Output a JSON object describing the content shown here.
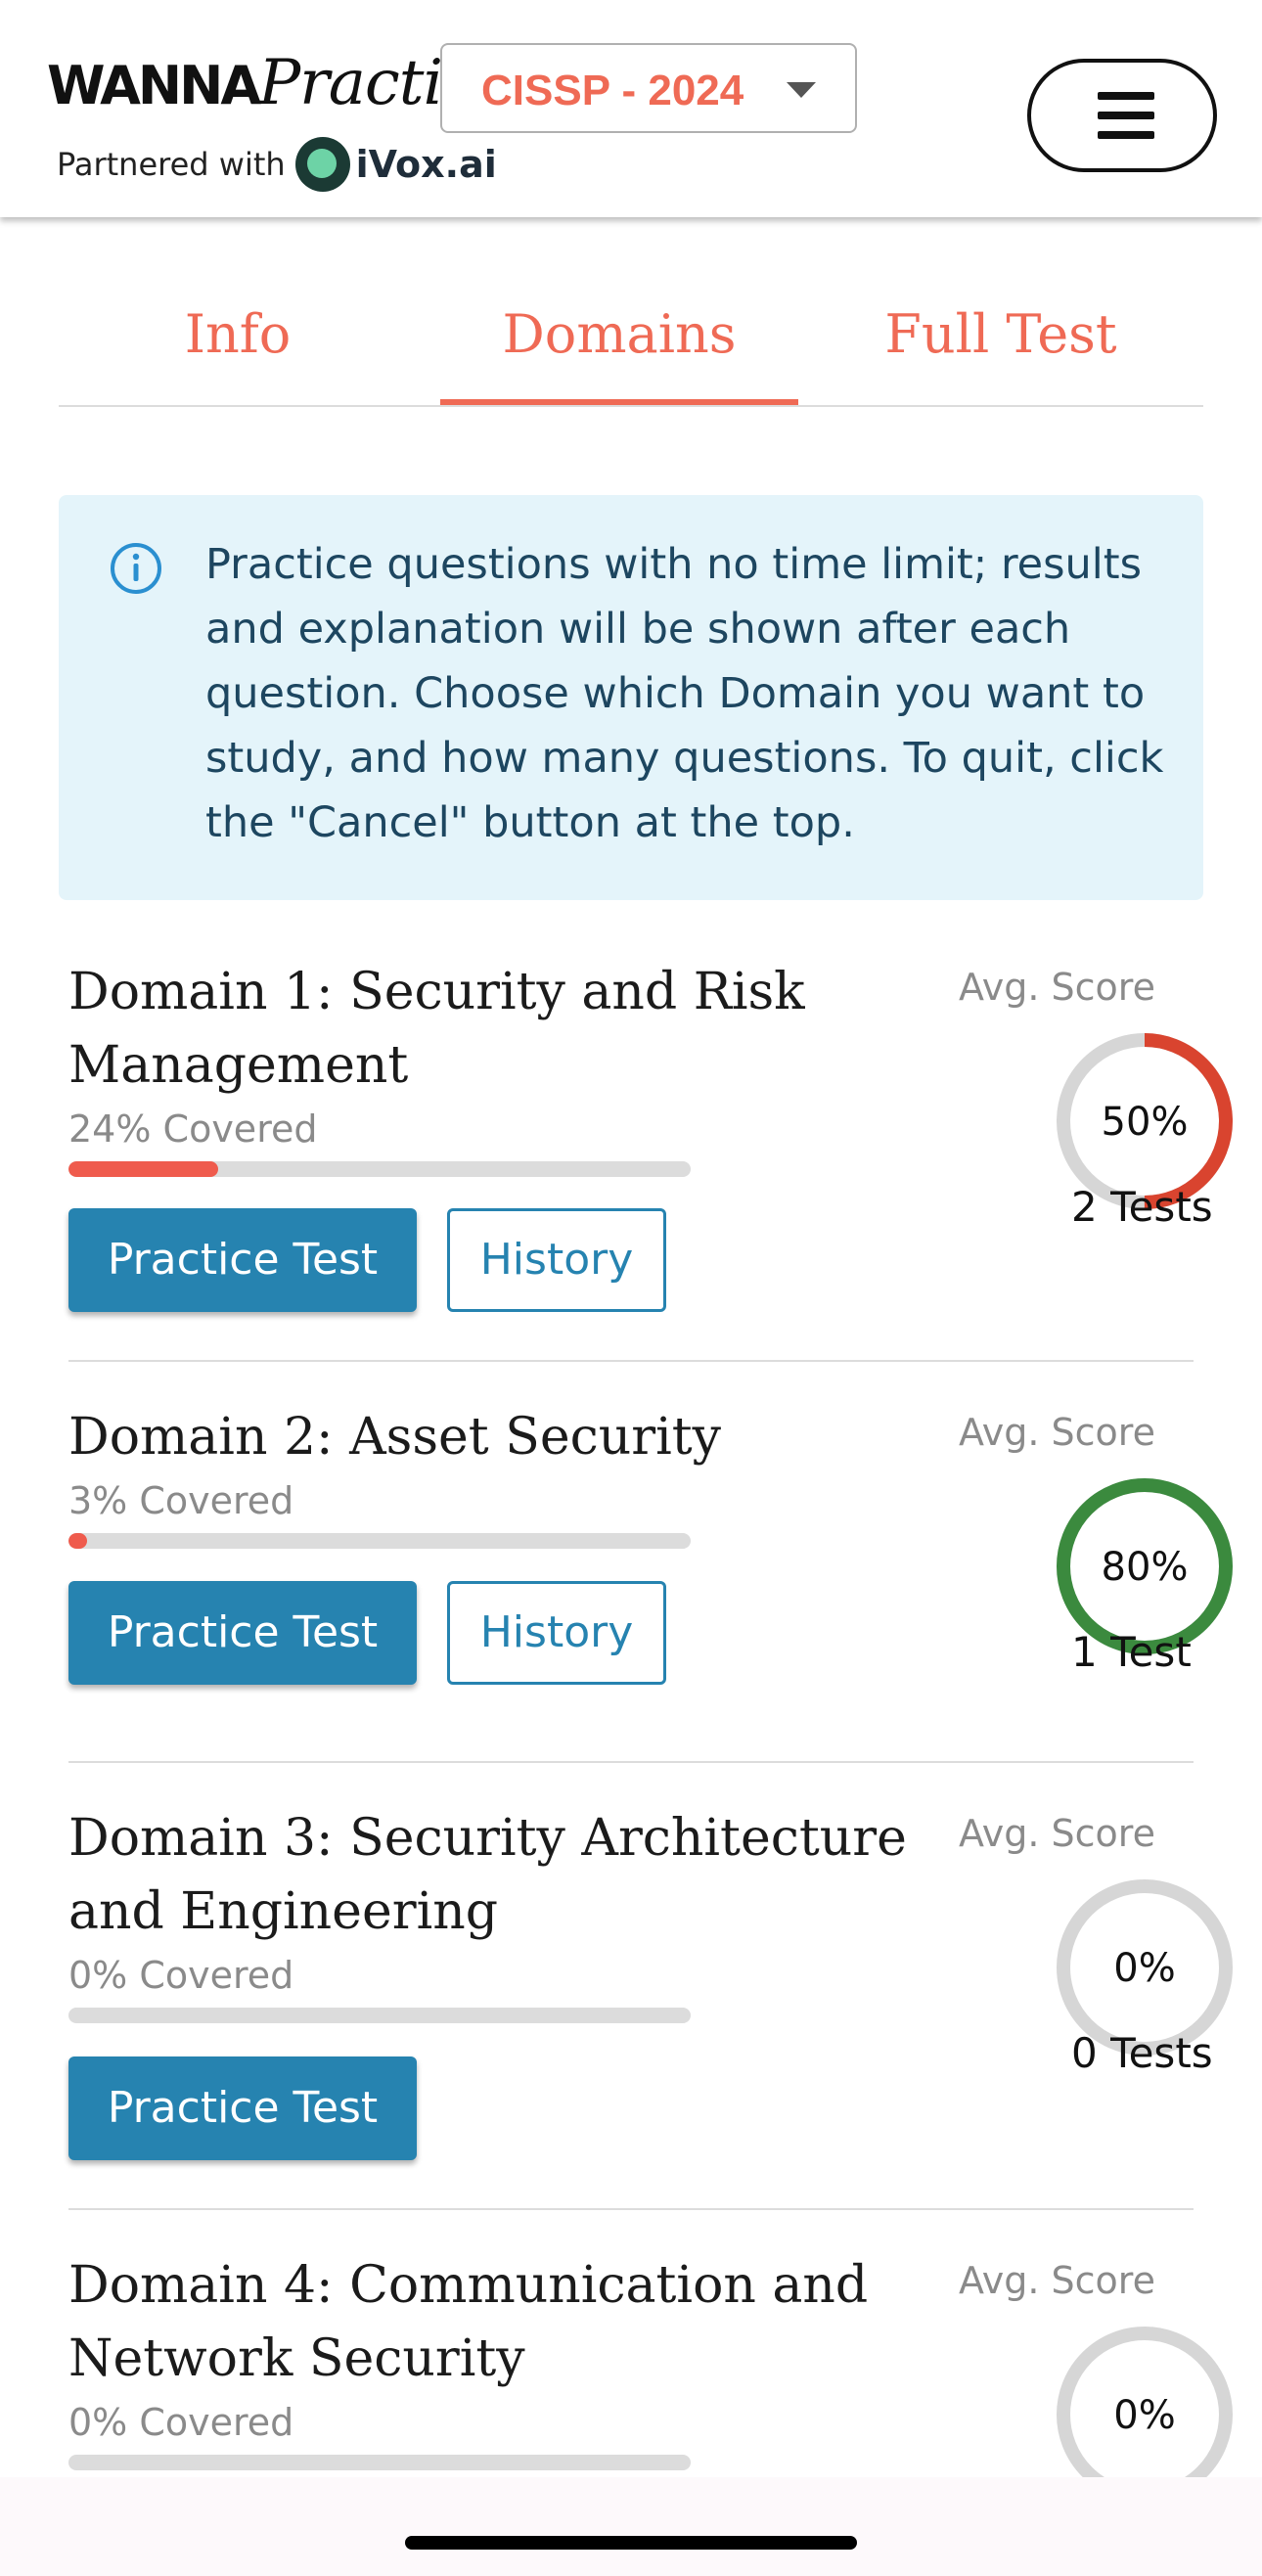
{
  "header": {
    "logo_wanna": "WANNA",
    "logo_practice": "Practice",
    "partnered_label": "Partnered with",
    "partner_name": "iVox.ai",
    "exam_select_value": "CISSP - 2024"
  },
  "tabs": [
    {
      "label": "Info",
      "active": false
    },
    {
      "label": "Domains",
      "active": true
    },
    {
      "label": "Full Test",
      "active": false
    }
  ],
  "info_box": {
    "icon": "info-circle-icon",
    "text": "Practice questions with no time limit; results and explanation will be shown after each question. Choose which Domain you want to study, and how many questions. To quit, click the \"Cancel\" button at the top."
  },
  "domains": [
    {
      "title": "Domain 1: Security and Risk Management",
      "covered_label": "24% Covered",
      "covered_fraction": 0.24,
      "practice_label": "Practice Test",
      "history_label": "History",
      "avg_score_label": "Avg. Score",
      "score_text": "50%",
      "score_fraction": 0.5,
      "score_color": "#d9442f",
      "tests_label": "2 Tests"
    },
    {
      "title": "Domain 2: Asset Security",
      "covered_label": "3% Covered",
      "covered_fraction": 0.03,
      "practice_label": "Practice Test",
      "history_label": "History",
      "avg_score_label": "Avg. Score",
      "score_text": "80%",
      "score_fraction": 1.0,
      "score_color": "#3b8a3e",
      "tests_label": "1 Test"
    },
    {
      "title": "Domain 3: Security Architecture and Engineering",
      "covered_label": "0% Covered",
      "covered_fraction": 0,
      "practice_label": "Practice Test",
      "avg_score_label": "Avg. Score",
      "score_text": "0%",
      "score_fraction": 0,
      "score_color": "#d9442f",
      "tests_label": "0 Tests"
    },
    {
      "title": "Domain 4: Communication and Network Security",
      "covered_label": "0% Covered",
      "covered_fraction": 0,
      "avg_score_label": "Avg. Score",
      "score_text": "0%",
      "score_fraction": 0,
      "score_color": "#d9442f"
    }
  ],
  "colors": {
    "accent": "#ef6a55",
    "button_blue": "#2683b0",
    "info_bg": "#e4f4fa",
    "progress_fill": "#ef5b4d",
    "ring_track": "#d6d6d6"
  }
}
